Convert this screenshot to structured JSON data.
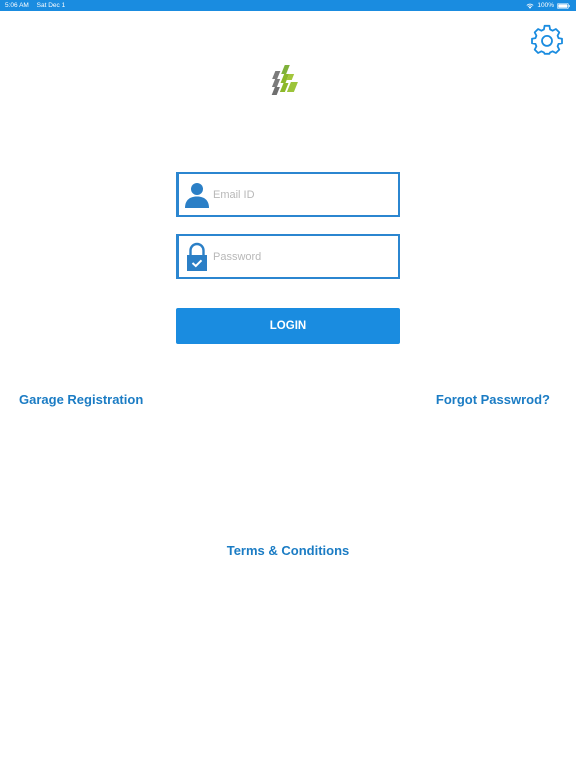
{
  "status_bar": {
    "time": "5:06 AM",
    "date": "Sat Dec 1",
    "battery": "100%",
    "wifi_icon": "wifi-icon",
    "battery_icon": "battery-icon"
  },
  "header": {
    "settings_icon": "gear-icon",
    "logo_icon": "brand-logo"
  },
  "login_form": {
    "email_placeholder": "Email ID",
    "email_value": "",
    "email_icon": "user-icon",
    "password_placeholder": "Password",
    "password_value": "",
    "password_icon": "lock-icon",
    "login_label": "LOGIN"
  },
  "links": {
    "garage_registration": "Garage Registration",
    "forgot_password": "Forgot Passwrod?",
    "terms": "Terms & Conditions"
  },
  "colors": {
    "accent": "#1a8ce0",
    "link": "#1b7cc4",
    "field_border": "#2b86d0",
    "logo_green": "#8cb82a",
    "logo_gray": "#7b7b7b"
  }
}
